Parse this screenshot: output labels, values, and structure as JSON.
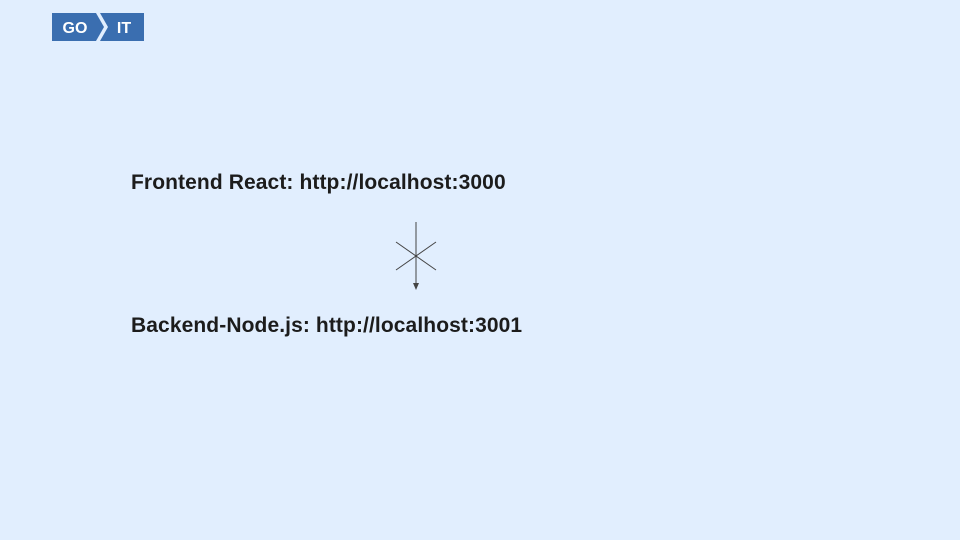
{
  "brand": {
    "logo_left": "GO",
    "logo_right": "IT",
    "color": "#3a6eb0"
  },
  "diagram": {
    "frontend": "Frontend React: http://localhost:3000",
    "backend": "Backend-Node.js: http://localhost:3001",
    "connector_icon": "arrow-down-with-cross-icon"
  }
}
